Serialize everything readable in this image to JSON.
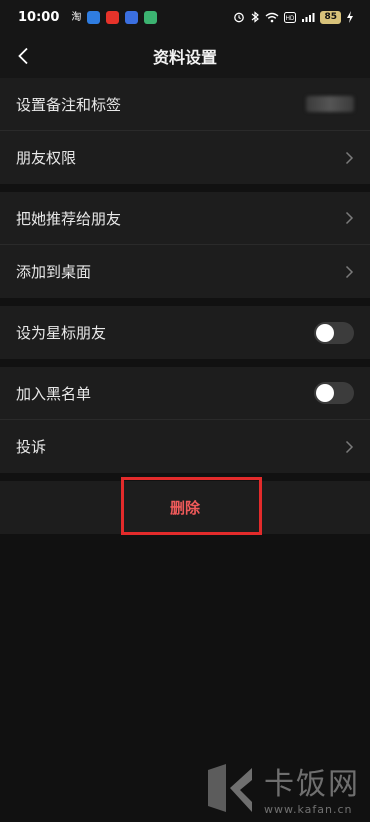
{
  "status_bar": {
    "time": "10:00",
    "app_text": "淘",
    "battery": "85"
  },
  "nav": {
    "title": "资料设置"
  },
  "groups": [
    {
      "items": [
        {
          "label": "设置备注和标签",
          "right": "blurred"
        },
        {
          "label": "朋友权限",
          "right": "chevron"
        }
      ]
    },
    {
      "items": [
        {
          "label": "把她推荐给朋友",
          "right": "chevron"
        },
        {
          "label": "添加到桌面",
          "right": "chevron"
        }
      ]
    },
    {
      "items": [
        {
          "label": "设为星标朋友",
          "right": "toggle",
          "checked": false
        }
      ]
    },
    {
      "items": [
        {
          "label": "加入黑名单",
          "right": "toggle",
          "checked": false
        },
        {
          "label": "投诉",
          "right": "chevron"
        }
      ]
    }
  ],
  "delete": {
    "label": "删除",
    "color": "#f05a5a",
    "highlight_color": "#e32b2b"
  },
  "watermark": {
    "brand": "卡饭网",
    "url": "www.kafan.cn"
  }
}
